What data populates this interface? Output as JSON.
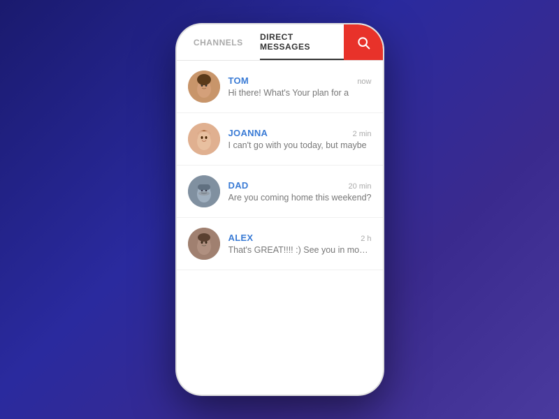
{
  "tabs": {
    "channels": {
      "label": "CHANNELS",
      "active": false
    },
    "directMessages": {
      "label": "DIRECT MESSAGES",
      "active": true
    }
  },
  "search": {
    "icon": "🔍"
  },
  "messages": [
    {
      "id": "tom",
      "sender": "TOM",
      "preview": "Hi there! What's Your plan for a",
      "time": "now",
      "avatarEmoji": "😊",
      "avatarClass": "avatar-tom"
    },
    {
      "id": "joanna",
      "sender": "JOANNA",
      "preview": "I can't go with you today, but maybe",
      "time": "2 min",
      "avatarEmoji": "👩",
      "avatarClass": "avatar-joanna"
    },
    {
      "id": "dad",
      "sender": "DAD",
      "preview": "Are you coming home this weekend?",
      "time": "20 min",
      "avatarEmoji": "👨",
      "avatarClass": "avatar-dad"
    },
    {
      "id": "alex",
      "sender": "ALEX",
      "preview": "That's GREAT!!!! :) See you in monday!",
      "time": "2 h",
      "avatarEmoji": "🧑",
      "avatarClass": "avatar-alex"
    }
  ],
  "colors": {
    "searchBg": "#e8322a",
    "activeTabColor": "#333",
    "senderColor": "#3a7bd5"
  }
}
